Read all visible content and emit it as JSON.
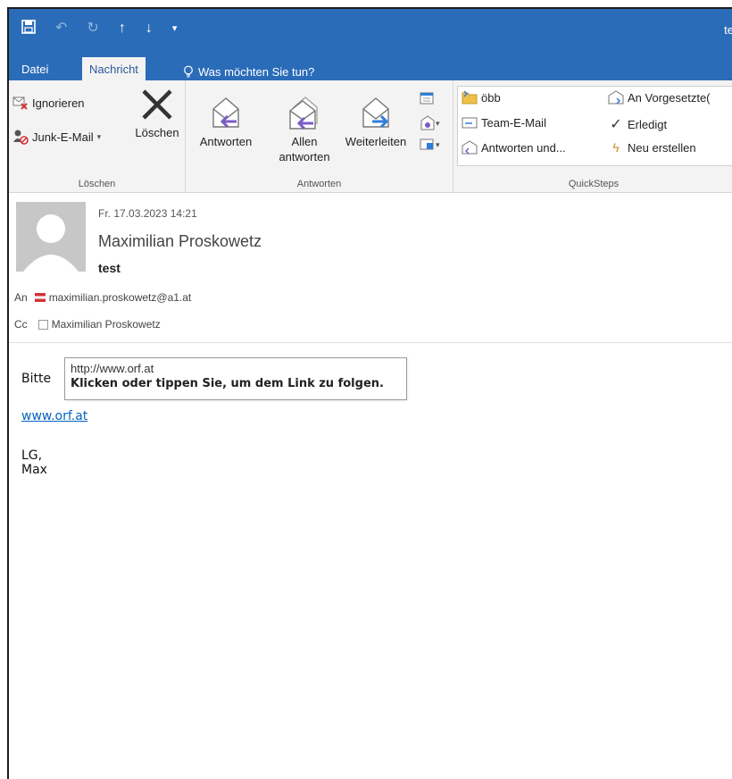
{
  "titlebar": {
    "title": "te",
    "qat": [
      "save-icon",
      "undo-icon",
      "redo-icon",
      "up-arrow-icon",
      "down-arrow-icon",
      "customize-icon"
    ]
  },
  "tabs": {
    "datei": "Datei",
    "nachricht": "Nachricht",
    "tellme": "Was möchten Sie tun?"
  },
  "ribbon": {
    "loeschen_group": {
      "label": "Löschen",
      "ignorieren": "Ignorieren",
      "junk": "Junk-E-Mail",
      "loeschen": "Löschen"
    },
    "antworten_group": {
      "label": "Antworten",
      "antworten": "Antworten",
      "allen_line1": "Allen",
      "allen_line2": "antworten",
      "weiterleiten": "Weiterleiten"
    },
    "quicksteps_group": {
      "label": "QuickSteps",
      "items": [
        "öbb",
        "Team-E-Mail",
        "Antworten und...",
        "An Vorgesetzte(",
        "Erledigt",
        "Neu erstellen"
      ]
    }
  },
  "message": {
    "date": "Fr. 17.03.2023 14:21",
    "sender": "Maximilian Proskowetz",
    "subject": "test",
    "to_label": "An",
    "to": "maximilian.proskowetz@a1.at",
    "cc_label": "Cc",
    "cc": "Maximilian Proskowetz",
    "body_line1": "Bitte",
    "link": "www.orf.at",
    "signoff": "LG, Max"
  },
  "tooltip": {
    "url": "http://www.orf.at",
    "hint": "Klicken oder tippen Sie, um dem Link zu folgen."
  },
  "colors": {
    "titlebar": "#2b6cb8",
    "ribbon": "#f3f3f3",
    "link": "#0563c1",
    "reply_arrow": "#7b5cc4",
    "forward_arrow": "#2f7ed8"
  }
}
